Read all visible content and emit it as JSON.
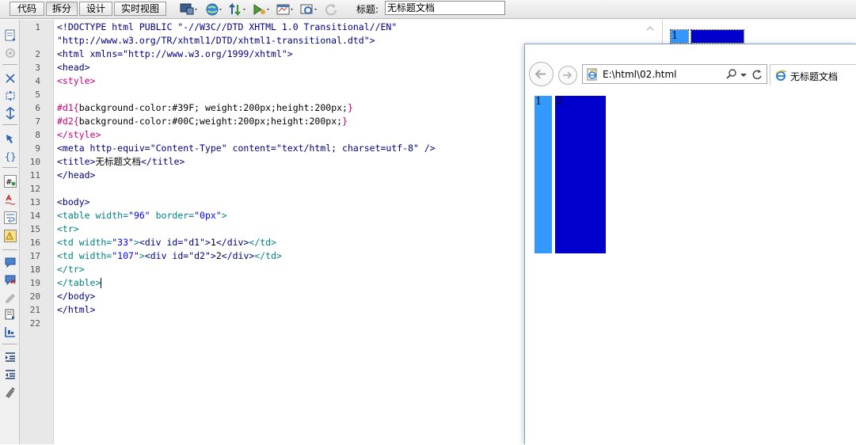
{
  "colors": {
    "d1": "#39F",
    "d2": "#00C",
    "toolbar_bg": "#e8e8e8",
    "accent_blue": "#0000cc"
  },
  "toolbar": {
    "view_buttons": [
      {
        "label": "代码"
      },
      {
        "label": "拆分"
      },
      {
        "label": "设计"
      },
      {
        "label": "实时视图"
      }
    ],
    "icons": [
      "multiscreen-icon",
      "globe-icon",
      "file-transfer-icon",
      "debug-icon",
      "visual-aids-icon",
      "view-options-icon",
      "refresh-icon"
    ],
    "title_label": "标题:",
    "title_value": "无标题文档"
  },
  "sidebar_tools": [
    "open-document-icon",
    "settings-icon",
    "collapse-tag-icon",
    "collapse-selection-icon",
    "expand-all-icon",
    "select-parent-icon",
    "balance-braces-icon",
    "line-numbers-icon",
    "highlight-invalid-icon",
    "word-wrap-icon",
    "syntax-error-icon",
    "apply-comment-icon",
    "remove-comment-icon",
    "wrap-tag-icon",
    "recent-snippets-icon",
    "move-css-icon",
    "indent-icon",
    "outdent-icon",
    "format-source-icon"
  ],
  "code": {
    "line_numbers": [
      "1",
      "2",
      "3",
      "4",
      "5",
      "6",
      "7",
      "8",
      "9",
      "10",
      "11",
      "12",
      "13",
      "14",
      "15",
      "16",
      "17",
      "18",
      "19",
      "20",
      "21",
      "22"
    ],
    "lines": [
      {
        "segments": [
          {
            "t": "<!DOCTYPE html PUBLIC \"-//W3C//DTD XHTML 1.0 Transitional//EN\"",
            "c": "tag"
          }
        ]
      },
      {
        "segments": [
          {
            "t": "\"http://www.w3.org/TR/xhtml1/DTD/xhtml1-transitional.dtd\">",
            "c": "tag"
          }
        ]
      },
      {
        "segments": [
          {
            "t": "<html xmlns=\"http://www.w3.org/1999/xhtml\">",
            "c": "tag"
          }
        ]
      },
      {
        "segments": [
          {
            "t": "<head>",
            "c": "tag"
          }
        ]
      },
      {
        "segments": [
          {
            "t": "<style>",
            "c": "css"
          }
        ]
      },
      {
        "segments": []
      },
      {
        "segments": [
          {
            "t": "#d1",
            "c": "css"
          },
          {
            "t": "{",
            "c": "css"
          },
          {
            "t": "background-color:#39F; weight:200px;height:200px;",
            "c": "cssv"
          },
          {
            "t": "}",
            "c": "css"
          }
        ]
      },
      {
        "segments": [
          {
            "t": "#d2",
            "c": "css"
          },
          {
            "t": "{",
            "c": "css"
          },
          {
            "t": "background-color:#00C;weight:200px;height:200px;",
            "c": "cssv"
          },
          {
            "t": "}",
            "c": "css"
          }
        ]
      },
      {
        "segments": [
          {
            "t": "</style>",
            "c": "css"
          }
        ]
      },
      {
        "segments": [
          {
            "t": "<meta http-equiv=\"Content-Type\" content=\"text/html; charset=utf-8\" />",
            "c": "tag"
          }
        ]
      },
      {
        "segments": [
          {
            "t": "<title>",
            "c": "tag"
          },
          {
            "t": "无标题文档",
            "c": "txt"
          },
          {
            "t": "</title>",
            "c": "tag"
          }
        ]
      },
      {
        "segments": [
          {
            "t": "</head>",
            "c": "tag"
          }
        ]
      },
      {
        "segments": []
      },
      {
        "segments": [
          {
            "t": "<body>",
            "c": "tag"
          }
        ]
      },
      {
        "segments": [
          {
            "t": "<table width=",
            "c": "tblc"
          },
          {
            "t": "\"96\"",
            "c": "attrv"
          },
          {
            "t": " border=",
            "c": "tblc"
          },
          {
            "t": "\"0px\"",
            "c": "attrv"
          },
          {
            "t": ">",
            "c": "tblc"
          }
        ]
      },
      {
        "segments": [
          {
            "t": "<tr>",
            "c": "tblc"
          }
        ]
      },
      {
        "segments": [
          {
            "t": "<td width=",
            "c": "tblc"
          },
          {
            "t": "\"33\"",
            "c": "attrv"
          },
          {
            "t": ">",
            "c": "tblc"
          },
          {
            "t": "<div id=\"d1\">",
            "c": "tag"
          },
          {
            "t": "1",
            "c": "txt"
          },
          {
            "t": "</div>",
            "c": "tag"
          },
          {
            "t": "</td>",
            "c": "tblc"
          }
        ]
      },
      {
        "segments": [
          {
            "t": "<td width=",
            "c": "tblc"
          },
          {
            "t": "\"107\"",
            "c": "attrv"
          },
          {
            "t": ">",
            "c": "tblc"
          },
          {
            "t": "<div id=\"d2\">",
            "c": "tag"
          },
          {
            "t": "2",
            "c": "txt"
          },
          {
            "t": "</div>",
            "c": "tag"
          },
          {
            "t": "</td>",
            "c": "tblc"
          }
        ]
      },
      {
        "segments": [
          {
            "t": "</tr>",
            "c": "tblc"
          }
        ]
      },
      {
        "segments": [
          {
            "t": "</table>",
            "c": "tblc"
          }
        ],
        "caret": true
      },
      {
        "segments": [
          {
            "t": "</body>",
            "c": "tag"
          }
        ]
      },
      {
        "segments": [
          {
            "t": "</html>",
            "c": "tag"
          }
        ]
      }
    ]
  },
  "browser": {
    "address": "E:\\html\\02.html",
    "tab_title": "无标题文档",
    "cells": [
      {
        "label": "1",
        "color": "#39F"
      },
      {
        "label": "2",
        "color": "#00C"
      }
    ]
  },
  "design_view": {
    "cells": [
      {
        "label": "1",
        "color": "#39F"
      },
      {
        "label": "",
        "color": "#00C"
      }
    ]
  }
}
